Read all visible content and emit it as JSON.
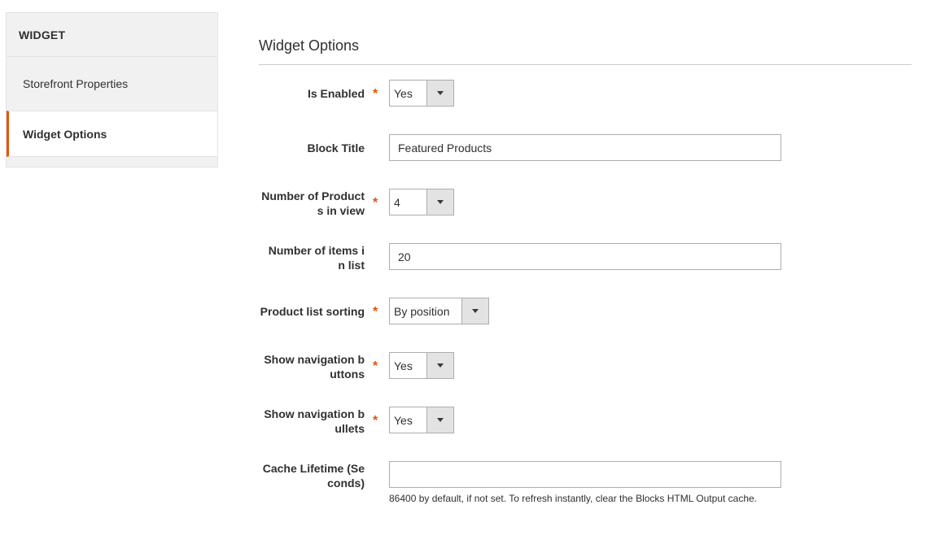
{
  "sidebar": {
    "title": "WIDGET",
    "items": [
      {
        "label": "Storefront Properties"
      },
      {
        "label": "Widget Options"
      }
    ]
  },
  "section": {
    "title": "Widget Options"
  },
  "required_mark": "*",
  "fields": {
    "is_enabled": {
      "label": "Is Enabled",
      "value": "Yes"
    },
    "block_title": {
      "label": "Block Title",
      "value": "Featured Products"
    },
    "products_in_view": {
      "label_line1": "Number of Product",
      "label_line2": "s in view",
      "value": "4"
    },
    "items_in_list": {
      "label_line1": "Number of items i",
      "label_line2": "n list",
      "value": "20"
    },
    "sorting": {
      "label": "Product list sorting",
      "value": "By position"
    },
    "nav_buttons": {
      "label_line1": "Show navigation b",
      "label_line2": "uttons",
      "value": "Yes"
    },
    "nav_bullets": {
      "label_line1": "Show navigation b",
      "label_line2": "ullets",
      "value": "Yes"
    },
    "cache_lifetime": {
      "label_line1": "Cache Lifetime (Se",
      "label_line2": "conds)",
      "value": "",
      "note": "86400 by default, if not set. To refresh instantly, clear the Blocks HTML Output cache."
    }
  },
  "colors": {
    "accent": "#eb5202"
  }
}
